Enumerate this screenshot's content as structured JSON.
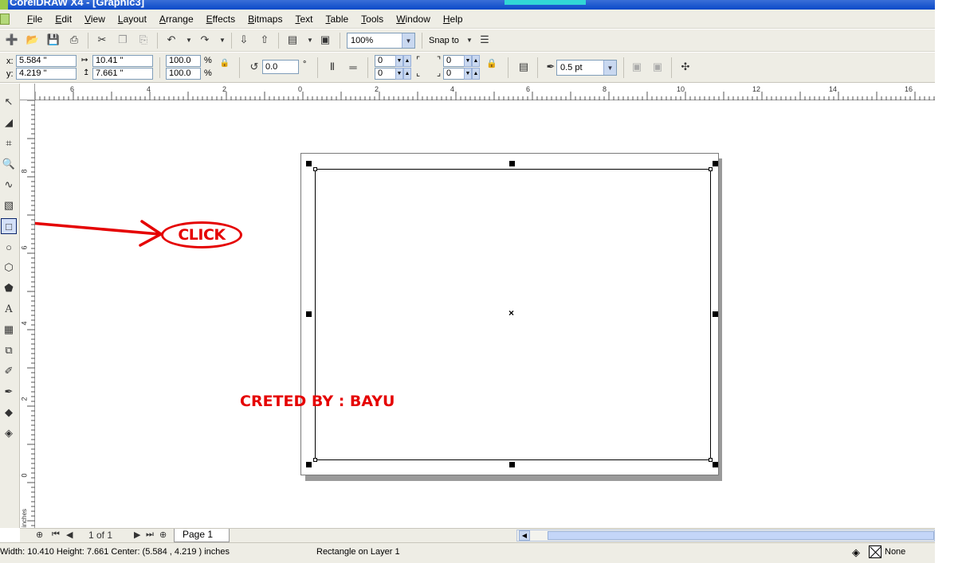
{
  "window": {
    "title": "CorelDRAW X4 - [Graphic3]"
  },
  "menu": [
    "File",
    "Edit",
    "View",
    "Layout",
    "Arrange",
    "Effects",
    "Bitmaps",
    "Text",
    "Table",
    "Tools",
    "Window",
    "Help"
  ],
  "toolbar": {
    "zoom": "100%",
    "snap_label": "Snap to"
  },
  "propertybar": {
    "x_label": "x:",
    "x_value": "5.584 \"",
    "y_label": "y:",
    "y_value": "4.219 \"",
    "width_value": "10.41 \"",
    "height_value": "7.661 \"",
    "scale_x": "100.0",
    "scale_y": "100.0",
    "percent": "%",
    "rotation": "0.0",
    "degree": "°",
    "corner_tl": "0",
    "corner_bl": "0",
    "corner_tr": "0",
    "corner_br": "0",
    "outline_width": "0.5 pt"
  },
  "ruler": {
    "top_labels": [
      "6",
      "4",
      "2",
      "0",
      "2",
      "4",
      "6",
      "8",
      "10",
      "12",
      "14",
      "16"
    ],
    "left_labels": [
      "8",
      "6",
      "4",
      "2",
      "0"
    ],
    "units": "inches"
  },
  "annotations": {
    "click": "CLICK",
    "credit": "CRETED BY : BAYU"
  },
  "pagenav": {
    "count": "1 of 1",
    "page_tab": "Page 1"
  },
  "status": {
    "dimensions": "Width: 10.410  Height: 7.661   Center: (5.584 , 4.219 )  inches",
    "object": "Rectangle on Layer 1",
    "fill": "None"
  },
  "colors": {
    "annotation": "#e50000",
    "title_bar": "#0a49c8",
    "chrome": "#eeede5"
  }
}
